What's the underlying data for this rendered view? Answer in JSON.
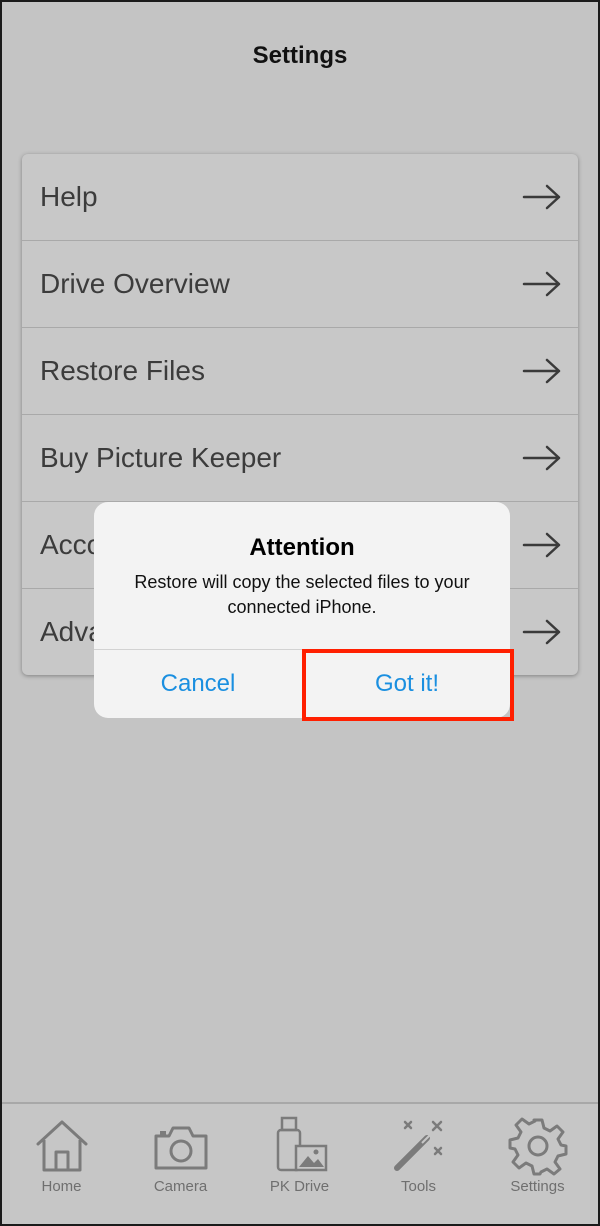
{
  "header": {
    "title": "Settings"
  },
  "menu": {
    "items": [
      {
        "label": "Help",
        "icon": "arrow-right-icon"
      },
      {
        "label": "Drive Overview",
        "icon": "arrow-right-icon"
      },
      {
        "label": "Restore Files",
        "icon": "arrow-right-icon"
      },
      {
        "label": "Buy Picture Keeper",
        "icon": "arrow-right-icon"
      },
      {
        "label": "Acco",
        "icon": "arrow-right-icon"
      },
      {
        "label": "Adva",
        "icon": "arrow-right-icon"
      }
    ]
  },
  "dialog": {
    "title": "Attention",
    "message": "Restore will copy the selected files to your connected iPhone.",
    "cancel_label": "Cancel",
    "ok_label": "Got it!",
    "highlight_color": "#ff1f00",
    "button_color": "#1a8fe0"
  },
  "tabbar": {
    "tabs": [
      {
        "label": "Home",
        "icon": "home-icon"
      },
      {
        "label": "Camera",
        "icon": "camera-icon"
      },
      {
        "label": "PK Drive",
        "icon": "pk-drive-icon"
      },
      {
        "label": "Tools",
        "icon": "magic-wand-icon"
      },
      {
        "label": "Settings",
        "icon": "gear-icon"
      }
    ]
  }
}
